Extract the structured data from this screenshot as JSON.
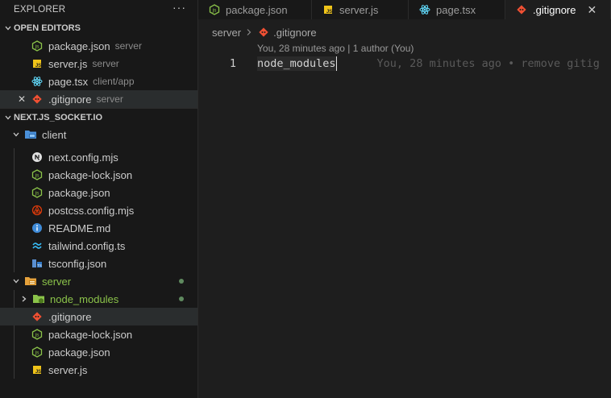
{
  "explorer": {
    "title": "EXPLORER",
    "more_label": "···"
  },
  "open_editors": {
    "title": "OPEN EDITORS",
    "items": [
      {
        "name": "package.json",
        "desc": "server",
        "icon": "nodejs-icon"
      },
      {
        "name": "server.js",
        "desc": "server",
        "icon": "js-icon"
      },
      {
        "name": "page.tsx",
        "desc": "client/app",
        "icon": "react-icon"
      },
      {
        "name": ".gitignore",
        "desc": "server",
        "icon": "git-icon"
      }
    ]
  },
  "project": {
    "title": "NEXT.JS_SOCKET.IO",
    "client": {
      "label": "client",
      "files": [
        {
          "name": "next.config.mjs",
          "icon": "next-icon"
        },
        {
          "name": "package-lock.json",
          "icon": "nodejs-icon"
        },
        {
          "name": "package.json",
          "icon": "nodejs-icon"
        },
        {
          "name": "postcss.config.mjs",
          "icon": "postcss-icon"
        },
        {
          "name": "README.md",
          "icon": "info-icon"
        },
        {
          "name": "tailwind.config.ts",
          "icon": "tailwind-icon"
        },
        {
          "name": "tsconfig.json",
          "icon": "tsconfig-icon"
        }
      ]
    },
    "server": {
      "label": "server",
      "node_modules": "node_modules",
      "files": [
        {
          "name": ".gitignore",
          "icon": "git-icon"
        },
        {
          "name": "package-lock.json",
          "icon": "nodejs-icon"
        },
        {
          "name": "package.json",
          "icon": "nodejs-icon"
        },
        {
          "name": "server.js",
          "icon": "js-icon"
        }
      ]
    }
  },
  "tabs": [
    {
      "label": "package.json",
      "icon": "nodejs-icon"
    },
    {
      "label": "server.js",
      "icon": "js-icon"
    },
    {
      "label": "page.tsx",
      "icon": "react-icon"
    },
    {
      "label": ".gitignore",
      "icon": "git-icon",
      "close": "✕"
    }
  ],
  "breadcrumb": {
    "folder": "server",
    "file": ".gitignore"
  },
  "editor": {
    "codelens": "You, 28 minutes ago | 1 author (You)",
    "line_number": "1",
    "code": "node_modules",
    "blame": "You, 28 minutes ago • remove gitig"
  },
  "colors": {
    "accent_git": "#f05033",
    "node_green": "#8bc34a",
    "js_yellow": "#f0c419",
    "react_blue": "#61dafb"
  }
}
